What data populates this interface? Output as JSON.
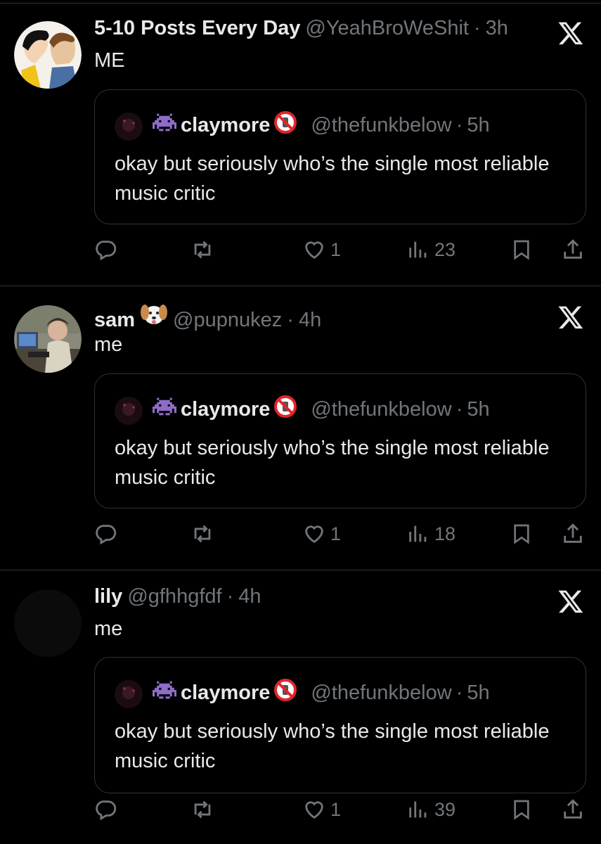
{
  "posts": [
    {
      "name": "5-10 Posts Every Day",
      "handle": "@YeahBroWeShit",
      "time": "3h",
      "text": "ME",
      "quote": {
        "name": "claymore",
        "handle": "@thefunkbelow",
        "time": "5h",
        "text": "okay but seriously who’s the single most reliable music critic"
      },
      "likes": "1",
      "views": "23"
    },
    {
      "name": "sam",
      "handle": "@pupnukez",
      "time": "4h",
      "text": "me",
      "quote": {
        "name": "claymore",
        "handle": "@thefunkbelow",
        "time": "5h",
        "text": "okay but seriously who’s the single most reliable music critic"
      },
      "likes": "1",
      "views": "18"
    },
    {
      "name": "lily",
      "handle": "@gfhhgfdf",
      "time": "4h",
      "text": "me",
      "quote": {
        "name": "claymore",
        "handle": "@thefunkbelow",
        "time": "5h",
        "text": "okay but seriously who’s the single most reliable music critic"
      },
      "likes": "1",
      "views": "39"
    }
  ],
  "separator": "·",
  "icons": {
    "reply": "reply-icon",
    "repost": "repost-icon",
    "like": "heart-icon",
    "views": "views-icon",
    "bookmark": "bookmark-icon",
    "share": "share-icon",
    "x": "x-logo-icon"
  },
  "colors": {
    "background": "#000000",
    "text": "#e7e9ea",
    "muted": "#71767b",
    "border": "#2f3336"
  }
}
